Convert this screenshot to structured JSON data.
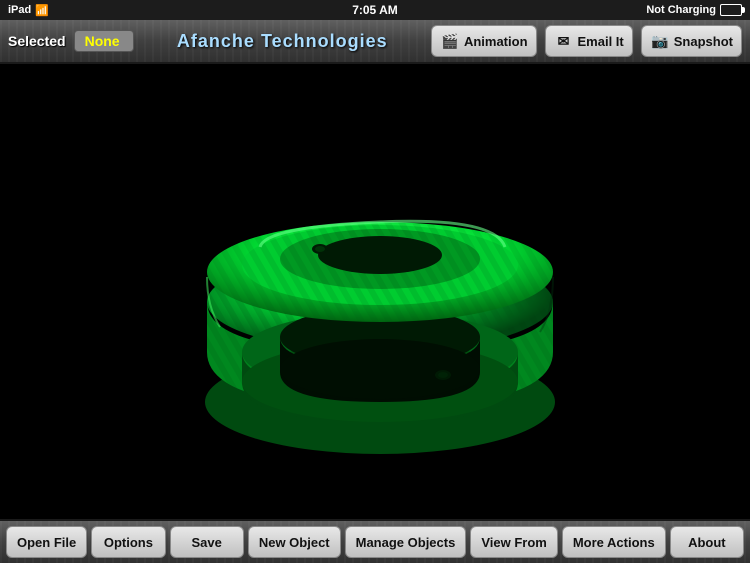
{
  "statusBar": {
    "device": "iPad",
    "time": "7:05 AM",
    "network": "Not Charging"
  },
  "toolbar": {
    "selectedLabel": "Selected",
    "selectedValue": "None",
    "appTitle": "Afanche Technologies",
    "animationBtn": "Animation",
    "emailBtn": "Email It",
    "snapshotBtn": "Snapshot"
  },
  "bottomToolbar": {
    "openFile": "Open File",
    "options": "Options",
    "save": "Save",
    "newObject": "New Object",
    "manageObjects": "Manage Objects",
    "viewFrom": "View From",
    "moreActions": "More Actions",
    "about": "About"
  },
  "icons": {
    "animation": "🎬",
    "email": "✉",
    "snapshot": "📷",
    "wifi": "wifi"
  }
}
